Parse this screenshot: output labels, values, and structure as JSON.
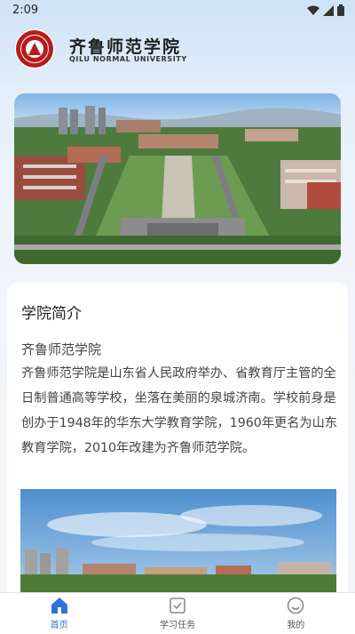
{
  "status_bar": {
    "time": "2:09"
  },
  "header": {
    "brand_cn": "齐鲁师范学院",
    "brand_en": "QILU NORMAL UNIVERSITY"
  },
  "intro": {
    "title": "学院简介",
    "subtitle": "齐鲁师范学院",
    "description": "齐鲁师范学院是山东省人民政府举办、省教育厅主管的全日制普通高等学校，坐落在美丽的泉城济南。学校前身是创办于1948年的华东大学教育学院，1960年更名为山东教育学院，2010年改建为齐鲁师范学院。"
  },
  "tabs": [
    {
      "label": "首页",
      "icon": "home-icon",
      "active": true
    },
    {
      "label": "学习任务",
      "icon": "task-icon",
      "active": false
    },
    {
      "label": "我的",
      "icon": "profile-icon",
      "active": false
    }
  ],
  "colors": {
    "accent": "#2e74d8",
    "brand_red": "#b71c1c"
  }
}
